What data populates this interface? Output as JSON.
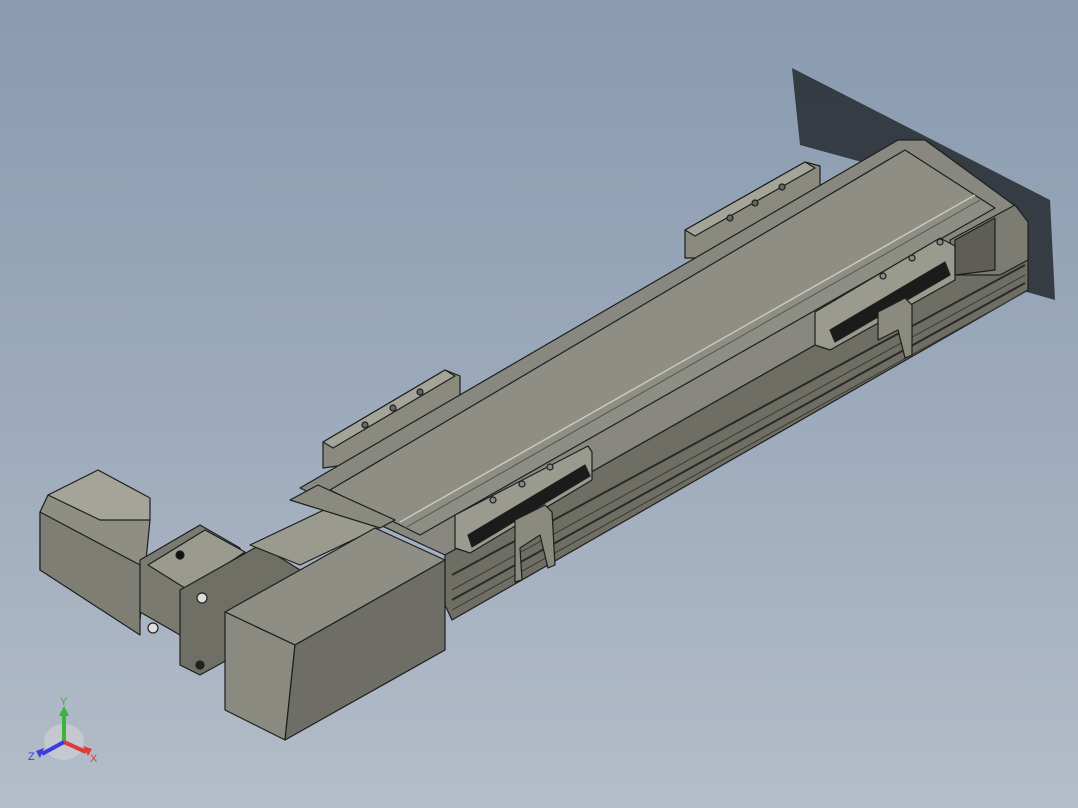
{
  "viewport": {
    "background_top": "#8a9bb0",
    "background_bottom": "#b4bdc9"
  },
  "model": {
    "body_color": "#8c8c80",
    "edge_color": "#1e1e1e",
    "shadow_color": "#2e333a"
  },
  "triad": {
    "x_label": "X",
    "y_label": "Y",
    "z_label": "Z",
    "x_color": "#e03a3a",
    "y_color": "#3ab43a",
    "z_color": "#3a3ae0"
  }
}
